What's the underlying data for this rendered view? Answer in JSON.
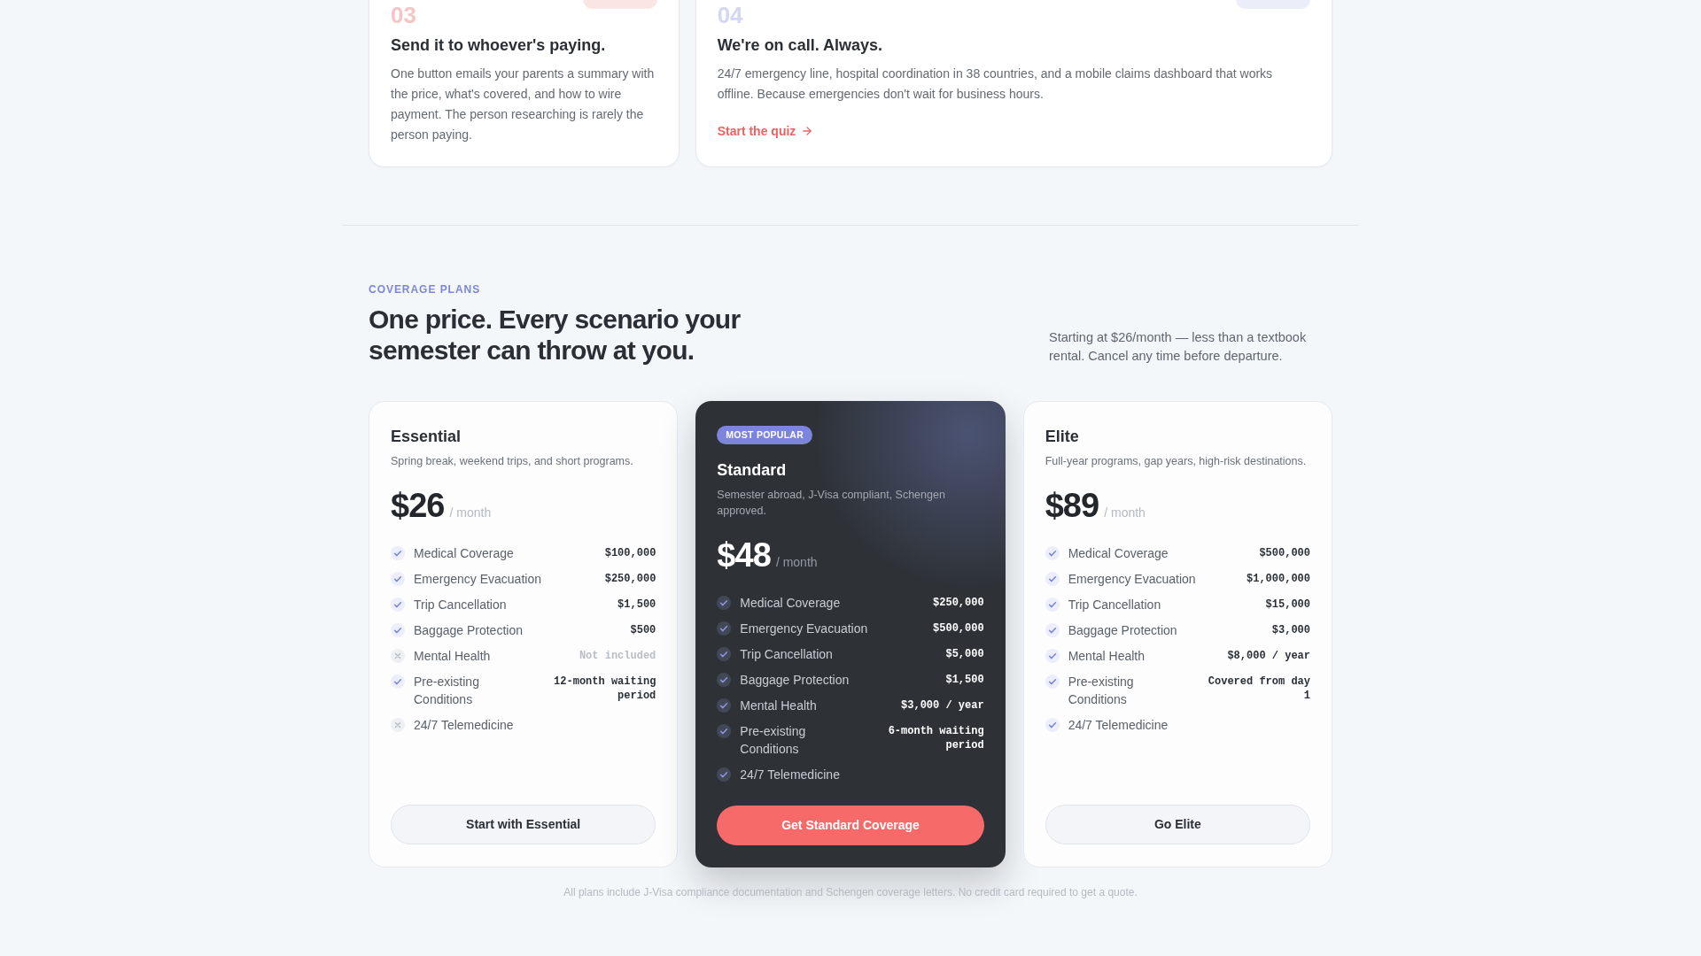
{
  "steps": [
    {
      "number": "03",
      "color": "#f6c4c4",
      "title": "Send it to whoever's paying.",
      "body": "One button emails your parents a summary with the price, what's covered, and how to wire payment. The person researching is rarely the person paying."
    },
    {
      "number": "04",
      "color": "#d3d7f2",
      "title": "We're on call. Always.",
      "body": "24/7 emergency line, hospital coordination in 38 countries, and a mobile claims dashboard that works offline. Because emergencies don't wait for business hours.",
      "link": "Start the quiz"
    }
  ],
  "plans_section": {
    "eyebrow": "COVERAGE PLANS",
    "title": "One price. Every scenario your semester can throw at you.",
    "intro": "Starting at $26/month — less than a textbook rental. Cancel any time before departure.",
    "plans": [
      {
        "name": "Essential",
        "featured": false,
        "description": "Spring break, weekend trips, and short programs.",
        "price": "$26",
        "period": "/ month",
        "features": [
          {
            "label": "Medical Coverage",
            "value": "$100,000",
            "included": true
          },
          {
            "label": "Emergency Evacuation",
            "value": "$250,000",
            "included": true
          },
          {
            "label": "Trip Cancellation",
            "value": "$1,500",
            "included": true
          },
          {
            "label": "Baggage Protection",
            "value": "$500",
            "included": true
          },
          {
            "label": "Mental Health",
            "value": "Not included",
            "included": false
          },
          {
            "label": "Pre-existing Conditions",
            "value": "12-month waiting period",
            "included": true
          },
          {
            "label": "24/7 Telemedicine",
            "included": false
          }
        ],
        "cta": "Start with Essential"
      },
      {
        "name": "Standard",
        "featured": true,
        "badge": "MOST POPULAR",
        "description": "Semester abroad, J-Visa compliant, Schengen approved.",
        "price": "$48",
        "period": "/ month",
        "features": [
          {
            "label": "Medical Coverage",
            "value": "$250,000",
            "included": true
          },
          {
            "label": "Emergency Evacuation",
            "value": "$500,000",
            "included": true
          },
          {
            "label": "Trip Cancellation",
            "value": "$5,000",
            "included": true
          },
          {
            "label": "Baggage Protection",
            "value": "$1,500",
            "included": true
          },
          {
            "label": "Mental Health",
            "value": "$3,000 / year",
            "included": true
          },
          {
            "label": "Pre-existing Conditions",
            "value": "6-month waiting period",
            "included": true
          },
          {
            "label": "24/7 Telemedicine",
            "included": true
          }
        ],
        "cta": "Get Standard Coverage"
      },
      {
        "name": "Elite",
        "featured": false,
        "description": "Full-year programs, gap years, high-risk destinations.",
        "price": "$89",
        "period": "/ month",
        "features": [
          {
            "label": "Medical Coverage",
            "value": "$500,000",
            "included": true
          },
          {
            "label": "Emergency Evacuation",
            "value": "$1,000,000",
            "included": true
          },
          {
            "label": "Trip Cancellation",
            "value": "$15,000",
            "included": true
          },
          {
            "label": "Baggage Protection",
            "value": "$3,000",
            "included": true
          },
          {
            "label": "Mental Health",
            "value": "$8,000 / year",
            "included": true
          },
          {
            "label": "Pre-existing Conditions",
            "value": "Covered from day 1",
            "included": true
          },
          {
            "label": "24/7 Telemedicine",
            "included": true
          }
        ],
        "cta": "Go Elite"
      }
    ],
    "footnote": "All plans include J-Visa compliance documentation and Schengen coverage letters. No credit card required to get a quote."
  }
}
